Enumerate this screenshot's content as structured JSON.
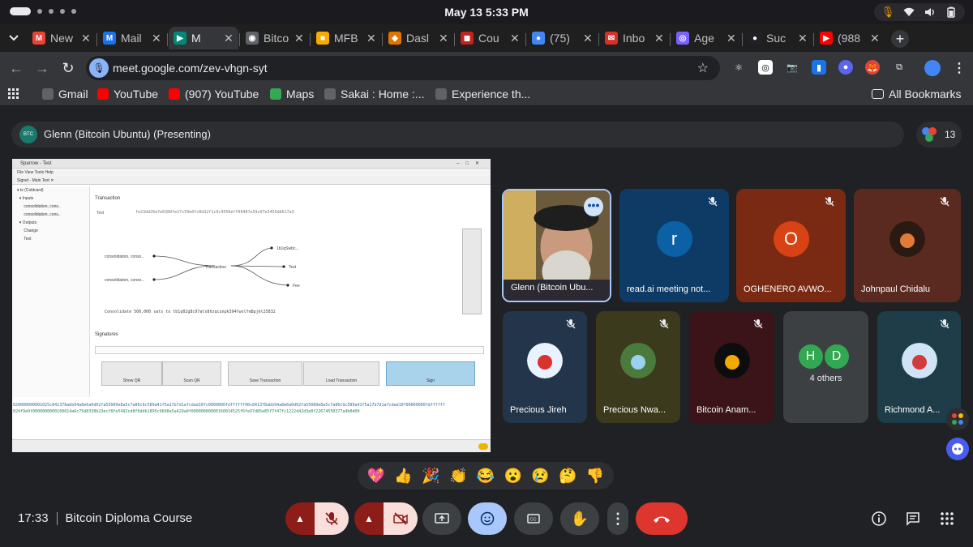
{
  "os": {
    "time": "May 13   5:33 PM"
  },
  "tabs": [
    {
      "label": "New",
      "fav": "M",
      "color": "#ea4335"
    },
    {
      "label": "Mail",
      "fav": "M",
      "color": "#1a73e8"
    },
    {
      "label": "M",
      "fav": "▶",
      "color": "#00897b"
    },
    {
      "label": "Bitco",
      "fav": "◉",
      "color": "#5f6368"
    },
    {
      "label": "MFB",
      "fav": "■",
      "color": "#f9ab00"
    },
    {
      "label": "Dasl",
      "fav": "◆",
      "color": "#e37400"
    },
    {
      "label": "Cou",
      "fav": "◼",
      "color": "#c5221f"
    },
    {
      "label": "(75)",
      "fav": "●",
      "color": "#4285f4"
    },
    {
      "label": "Inbo",
      "fav": "✉",
      "color": "#d93025"
    },
    {
      "label": "Age",
      "fav": "◎",
      "color": "#7b61ff"
    },
    {
      "label": "Suc",
      "fav": "●",
      "color": "#202124"
    },
    {
      "label": "(988",
      "fav": "▶",
      "color": "#ff0000"
    }
  ],
  "address": {
    "url": "meet.google.com/zev-vhgn-syt"
  },
  "bookmarks": [
    {
      "label": "Gmail",
      "color": "#5f6368"
    },
    {
      "label": "YouTube",
      "color": "#ff0000"
    },
    {
      "label": "(907) YouTube",
      "color": "#ff0000"
    },
    {
      "label": "Maps",
      "color": "#34a853"
    },
    {
      "label": "Sakai : Home :...",
      "color": "#5f6368"
    },
    {
      "label": "Experience th...",
      "color": "#5f6368"
    }
  ],
  "all_bookmarks": "All Bookmarks",
  "meet": {
    "presenter": "Glenn (Bitcoin Ubuntu) (Presenting)",
    "people_count": "13",
    "participants": [
      {
        "name": "Glenn (Bitcoin Ubu...",
        "kind": "photo"
      },
      {
        "name": "read.ai meeting not...",
        "kind": "letter",
        "letter": "r",
        "bg": "#0e3b66",
        "av": "#0b61a4"
      },
      {
        "name": "OGHENERO AVWO...",
        "kind": "letter",
        "letter": "O",
        "bg": "#7a2a12",
        "av": "#d84315"
      },
      {
        "name": "Johnpaul Chidalu",
        "kind": "photo"
      },
      {
        "name": "Precious Jireh",
        "kind": "photo"
      },
      {
        "name": "Precious Nwa...",
        "kind": "photo"
      },
      {
        "name": "Bitcoin Anam...",
        "kind": "photo"
      },
      {
        "name": "4 others",
        "kind": "others"
      },
      {
        "name": "Richmond A...",
        "kind": "photo"
      }
    ],
    "others_letters": [
      "H",
      "D"
    ],
    "reactions": [
      "💖",
      "👍",
      "🎉",
      "👏",
      "😂",
      "😮",
      "😢",
      "🤔",
      "👎"
    ],
    "meeting_time": "17:33",
    "meeting_title": "Bitcoin Diploma Course"
  },
  "shared": {
    "window_title": "Sparrow - Test",
    "menu": "File   View   Tools   Help",
    "tabs": "Signet - Main   Test ✕",
    "sidebar": [
      "▾ tx (Coldcard)",
      "  ▾ Inputs",
      "      consolidation, cons..",
      "      consolidation, cons..",
      "  ▾ Outputs",
      "      Change",
      "      Test"
    ],
    "tx_heading": "Transaction",
    "tx_label": "Test",
    "tx_id": "fe23dd26e7e6389fe27c59e0fc8d32f1c9c4550eff00487e59c07e3455db617a3",
    "graph_in1": "consolidation, conso...",
    "graph_in2": "consolidation, conso...",
    "graph_center": "Transaction",
    "graph_out1": "1b1qSwbc...",
    "graph_out2": "Test",
    "graph_out3": "Fee",
    "consolidate": "Consolidate 500,000 sats to tb1q02g8c97ats8hzqcunpk394fwxlfm8pjkt25832",
    "signatures": "Signatures",
    "buttons": [
      "Show QR",
      "Scan QR",
      "Save Transaction",
      "Load Transaction",
      "Sign"
    ],
    "hex1": "020000000001025c841378abb94a8e6a0d02fa55089e8a5c7a86c9c589a41f5a17b7d1afcdad10fc0000000fdffffff90c841378abb94a8e6a0d02fa55089e8a5c7a86c9c589a41f5a17b7d1afcdad10f00000000fdffffff",
    "hex2": "024f9e0f0000000000160014a6c75d8338b23ecf8fe5492cd8f6ddb1895c9698a5a429a0f00000000000160014525f6fe97d85e85f7f47fc1222d42d3e8f22674550377a4b0d00"
  }
}
